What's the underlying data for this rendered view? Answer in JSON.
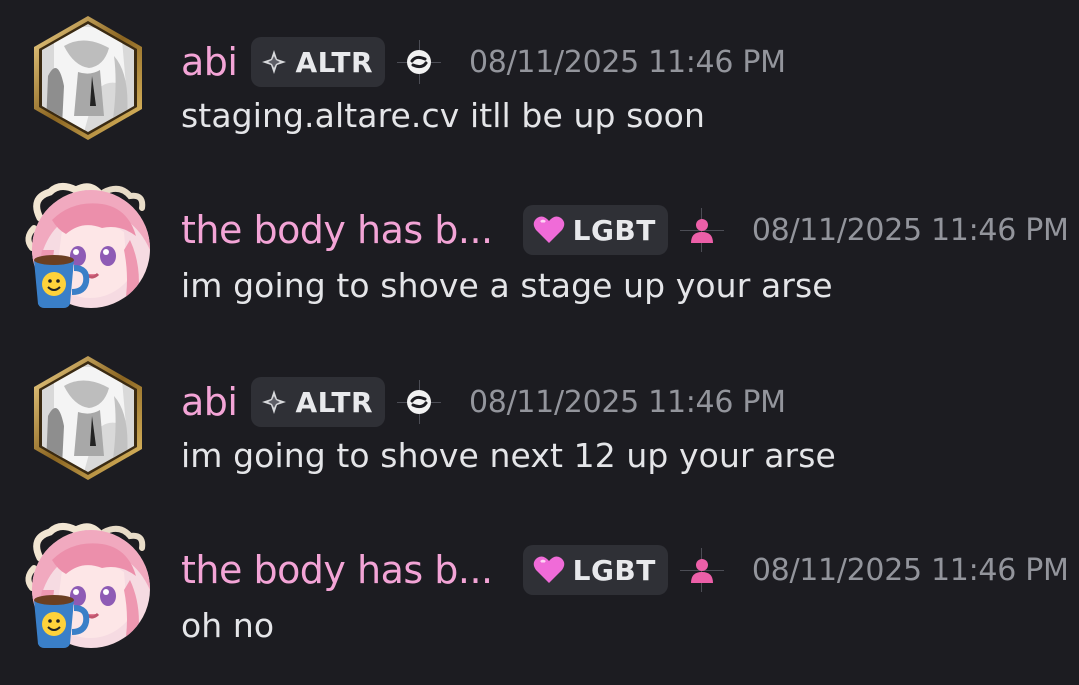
{
  "messages": [
    {
      "username": "abi",
      "tag": "ALTR",
      "tag_icon": "diamond-sparkle-icon",
      "role_icon": "swirl-icon",
      "timestamp": "08/11/2025 11:46 PM",
      "content": "staging.altare.cv itll be up soon",
      "avatar": "hexagon-avatar"
    },
    {
      "username": "the body has b...",
      "tag": "LGBT",
      "tag_icon": "pink-heart-icon",
      "role_icon": "person-icon",
      "timestamp": "08/11/2025 11:46 PM",
      "content": "im going to shove a stage up your arse",
      "avatar": "round-avatar-coffee"
    },
    {
      "username": "abi",
      "tag": "ALTR",
      "tag_icon": "diamond-sparkle-icon",
      "role_icon": "swirl-icon",
      "timestamp": "08/11/2025 11:46 PM",
      "content": "im going to shove next 12 up your arse",
      "avatar": "hexagon-avatar"
    },
    {
      "username": "the body has b...",
      "tag": "LGBT",
      "tag_icon": "pink-heart-icon",
      "role_icon": "person-icon",
      "timestamp": "08/11/2025 11:46 PM",
      "content": "oh no",
      "avatar": "round-avatar-coffee"
    }
  ],
  "colors": {
    "background": "#1c1c21",
    "username": "#f3a4d6",
    "timestamp": "#93959c",
    "tag_bg": "#2f3036",
    "text": "#e4e5e8"
  }
}
